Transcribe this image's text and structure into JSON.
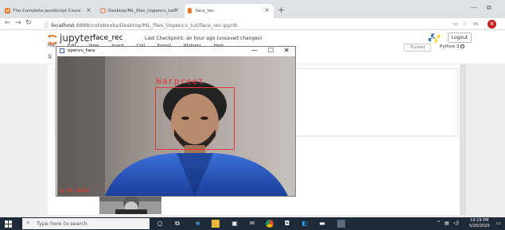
{
  "browser": {
    "tabs": [
      {
        "title": "The Complete JavaScript Cours·"
      },
      {
        "title": "Desktop/ML_files_l/opencv_tut/"
      },
      {
        "title": "face_rec"
      }
    ],
    "url_host": "localhost",
    "url_path": ":8888/notebooks/Desktop/ML_files_l/opencv_tut/face_rec.ipynb",
    "profile_initial": "N"
  },
  "jupyter": {
    "brand": "jupyter",
    "notebook_name": "face_rec",
    "checkpoint": "Last Checkpoint: an hour ago  (unsaved changes)",
    "logout_label": "Logout",
    "menu": [
      "File",
      "Edit",
      "View",
      "Insert",
      "Cell",
      "Kernel",
      "Widgets",
      "Help"
    ],
    "trusted_label": "Trusted",
    "kernel_label": "Python 3"
  },
  "cv_window": {
    "title": "opencv_face",
    "face_label": "Harpreet",
    "exit_label": "q to exit"
  },
  "taskbar": {
    "search_placeholder": "Type here to search",
    "time": "10:19 PM",
    "date": "5/20/2020"
  },
  "colors": {
    "detection": "#e53935",
    "taskbar": "#1f2a38",
    "jupyter_orange": "#f37726"
  }
}
